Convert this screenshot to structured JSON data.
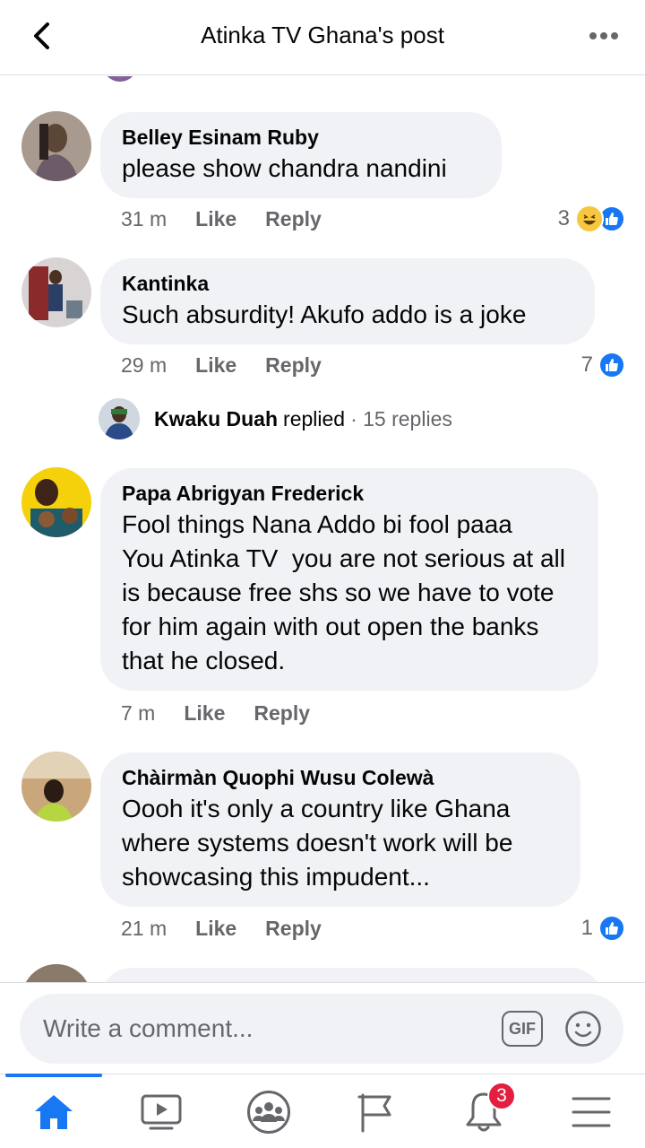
{
  "header": {
    "title": "Atinka TV Ghana's post"
  },
  "comments": [
    {
      "author": "Belley Esinam Ruby",
      "text": "please show chandra nandini",
      "time": "31 m",
      "like_label": "Like",
      "reply_label": "Reply",
      "reaction_count": "3",
      "reactions": [
        "haha",
        "like"
      ]
    },
    {
      "author": "Kantinka",
      "text": "Such absurdity! Akufo addo is a joke",
      "time": "29 m",
      "like_label": "Like",
      "reply_label": "Reply",
      "reaction_count": "7",
      "reactions": [
        "like"
      ],
      "replies": {
        "who": "Kwaku Duah",
        "verb": "replied",
        "count": "· 15 replies"
      }
    },
    {
      "author": "Papa Abrigyan Frederick",
      "text": "Fool things Nana Addo bi fool paaa\nYou Atinka TV  you are not serious at all is because free shs so we have to vote for him again with out open the banks that he closed.",
      "time": "7 m",
      "like_label": "Like",
      "reply_label": "Reply"
    },
    {
      "author": "Chàirmàn Quophi Wusu Colewà",
      "text": "Oooh it's only a country like Ghana where systems doesn't work will be showcasing this impudent...",
      "time": "21 m",
      "like_label": "Like",
      "reply_label": "Reply",
      "reaction_count": "1",
      "reactions": [
        "like"
      ]
    }
  ],
  "composer": {
    "placeholder": "Write a comment...",
    "gif_label": "GIF"
  },
  "bottom_nav": {
    "items": [
      "home-icon",
      "watch-icon",
      "groups-icon",
      "pages-icon",
      "notifications-icon",
      "menu-icon"
    ],
    "notification_badge": "3",
    "active_color": "#1877f2"
  },
  "colors": {
    "accent": "#1877f2",
    "bubble": "#f0f2f5",
    "meta": "#65676b",
    "badge": "#e41e3f"
  }
}
